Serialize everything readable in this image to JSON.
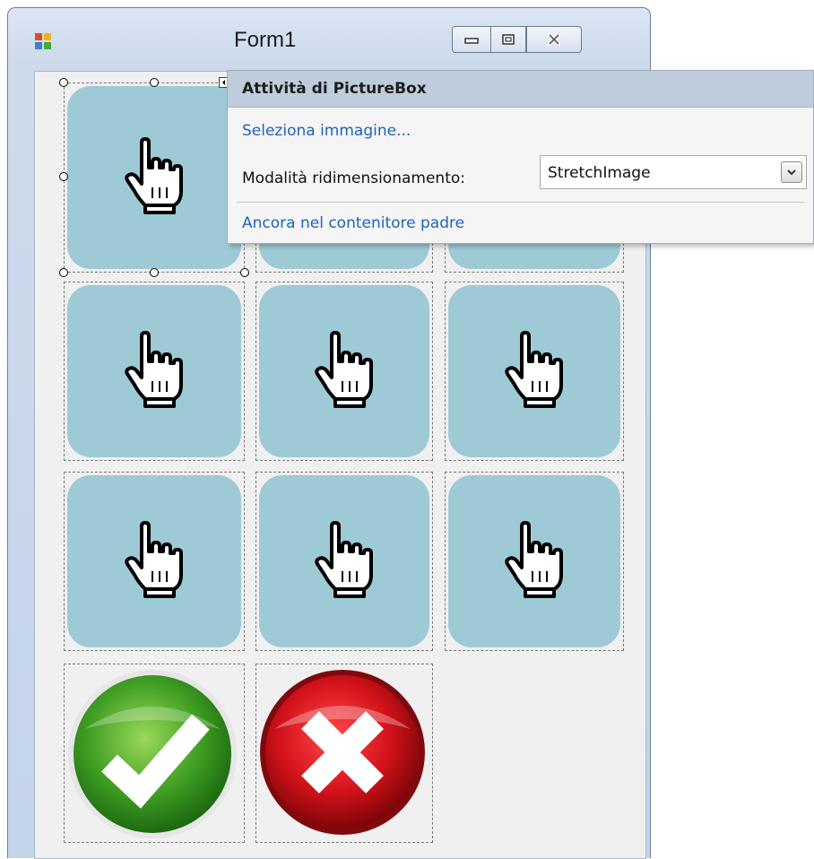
{
  "window": {
    "title": "Form1",
    "icons": {
      "app": "form-app-icon",
      "minimize": "minimize-icon",
      "maximize": "maximize-icon",
      "close": "close-icon"
    }
  },
  "form": {
    "picture_boxes": [
      {
        "image": "hand-pointer-icon",
        "selected": true
      },
      {
        "image": "hand-pointer-icon"
      },
      {
        "image": "hand-pointer-icon"
      },
      {
        "image": "hand-pointer-icon"
      },
      {
        "image": "hand-pointer-icon"
      },
      {
        "image": "hand-pointer-icon"
      },
      {
        "image": "hand-pointer-icon"
      },
      {
        "image": "hand-pointer-icon"
      },
      {
        "image": "hand-pointer-icon"
      },
      {
        "image": "green-check-icon"
      },
      {
        "image": "red-x-icon"
      }
    ],
    "colors": {
      "tile": "#9ecad6",
      "check_green": "#3a9a1e",
      "x_red": "#c8121a"
    }
  },
  "task_panel": {
    "title": "Attività di PictureBox",
    "select_image_link": "Seleziona immagine...",
    "size_mode_label": "Modalità ridimensionamento:",
    "size_mode_value": "StretchImage",
    "dock_link": "Ancora nel contenitore padre"
  }
}
